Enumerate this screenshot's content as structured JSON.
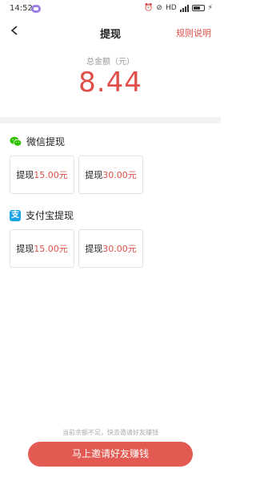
{
  "status_bar": {
    "time": "14:52",
    "network_label": "HD"
  },
  "header": {
    "title": "提现",
    "rules_link": "规则说明"
  },
  "balance": {
    "label": "总金额（元）",
    "amount": "8.44"
  },
  "wechat": {
    "title": "微信提现",
    "options": [
      {
        "prefix": "提现",
        "amount": "15.00元"
      },
      {
        "prefix": "提现",
        "amount": "30.00元"
      }
    ]
  },
  "alipay": {
    "title": "支付宝提现",
    "icon_glyph": "支",
    "options": [
      {
        "prefix": "提现",
        "amount": "15.00元"
      },
      {
        "prefix": "提现",
        "amount": "30.00元"
      }
    ]
  },
  "footer": {
    "hint": "当前余额不足，快去邀请好友赚钱",
    "cta_label": "马上邀请好友赚钱"
  },
  "colors": {
    "accent": "#e0504a",
    "wechat_green": "#2dc100",
    "alipay_blue": "#1ba1e6"
  }
}
